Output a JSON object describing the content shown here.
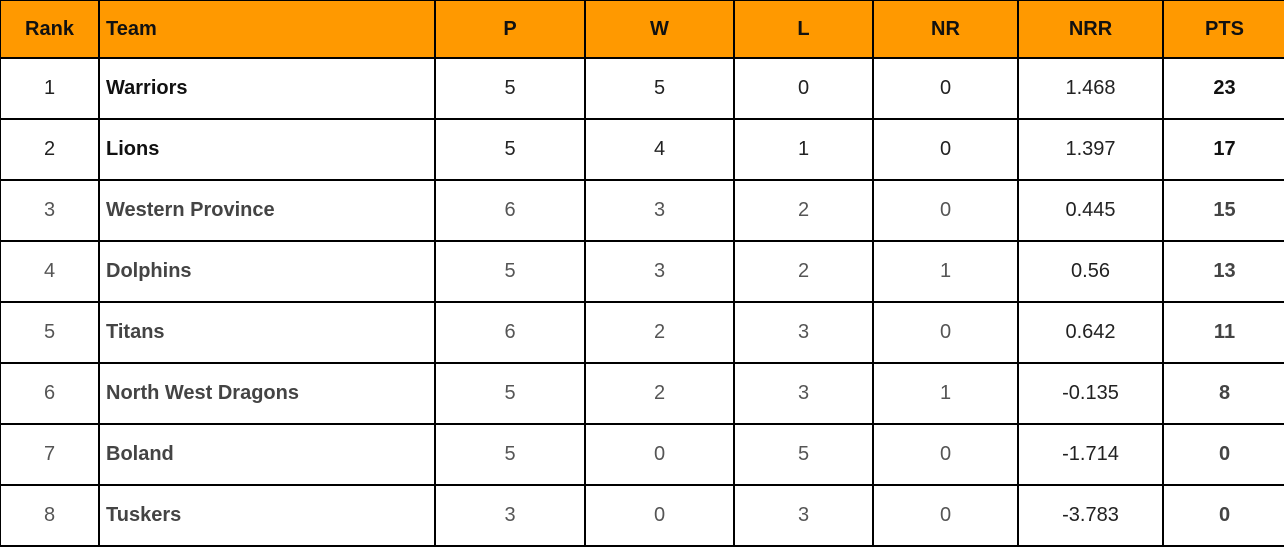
{
  "table": {
    "headers": [
      "Rank",
      "Team",
      "P",
      "W",
      "L",
      "NR",
      "NRR",
      "PTS"
    ],
    "header_color": "#ff9900",
    "rows": [
      {
        "rank": "1",
        "team": "Warriors",
        "p": "5",
        "w": "5",
        "l": "0",
        "nr": "0",
        "nrr": "1.468",
        "pts": "23"
      },
      {
        "rank": "2",
        "team": "Lions",
        "p": "5",
        "w": "4",
        "l": "1",
        "nr": "0",
        "nrr": "1.397",
        "pts": "17"
      },
      {
        "rank": "3",
        "team": "Western Province",
        "p": "6",
        "w": "3",
        "l": "2",
        "nr": "0",
        "nrr": "0.445",
        "pts": "15"
      },
      {
        "rank": "4",
        "team": "Dolphins",
        "p": "5",
        "w": "3",
        "l": "2",
        "nr": "1",
        "nrr": "0.56",
        "pts": "13"
      },
      {
        "rank": "5",
        "team": "Titans",
        "p": "6",
        "w": "2",
        "l": "3",
        "nr": "0",
        "nrr": "0.642",
        "pts": "11"
      },
      {
        "rank": "6",
        "team": "North West Dragons",
        "p": "5",
        "w": "2",
        "l": "3",
        "nr": "1",
        "nrr": "-0.135",
        "pts": "8"
      },
      {
        "rank": "7",
        "team": "Boland",
        "p": "5",
        "w": "0",
        "l": "5",
        "nr": "0",
        "nrr": "-1.714",
        "pts": "0"
      },
      {
        "rank": "8",
        "team": "Tuskers",
        "p": "3",
        "w": "0",
        "l": "3",
        "nr": "0",
        "nrr": "-3.783",
        "pts": "0"
      }
    ]
  }
}
